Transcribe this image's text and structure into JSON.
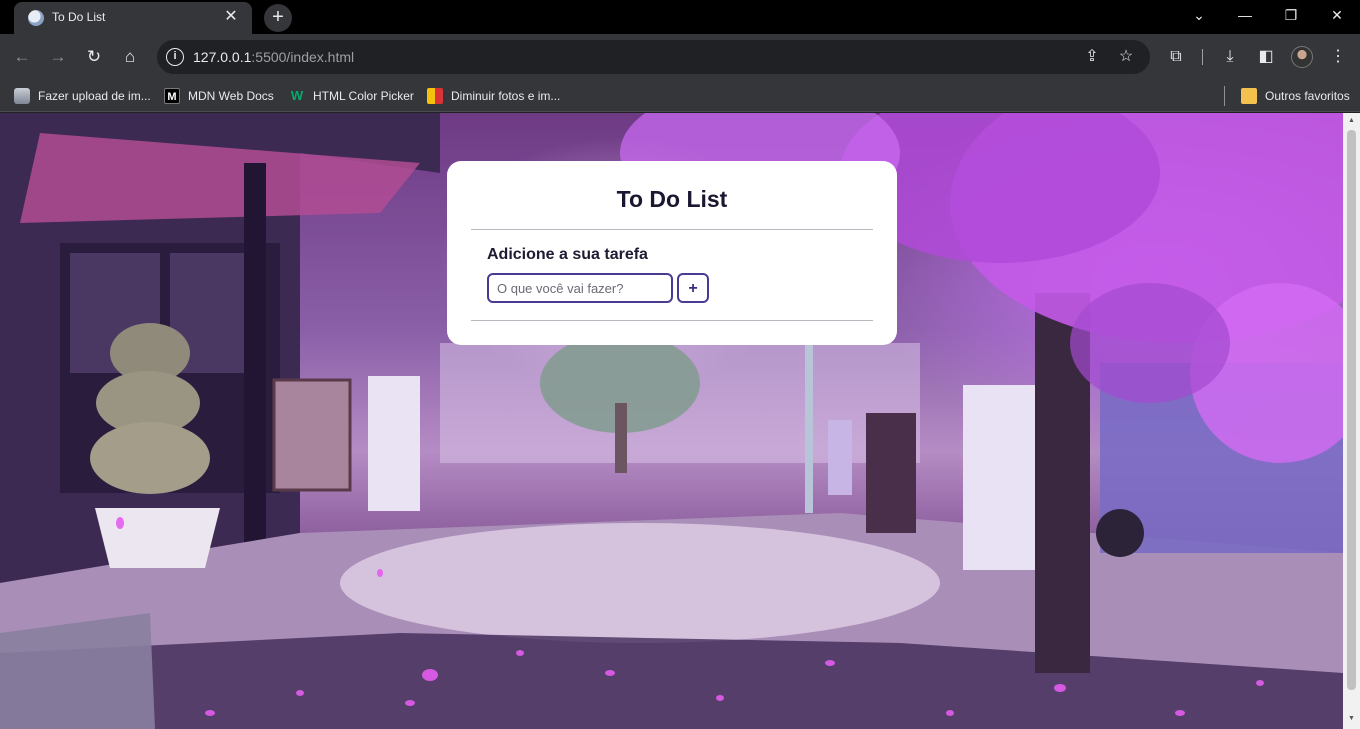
{
  "browser": {
    "tab": {
      "title": "To Do List",
      "close_glyph": "✕"
    },
    "new_tab_glyph": "+",
    "window_controls": {
      "minimize": "—",
      "restore": "❐",
      "close": "✕",
      "tabsearch": "⌄"
    },
    "address": {
      "host": "127.0.0.1",
      "rest": ":5500/index.html"
    },
    "bookmarks": [
      {
        "label": "Fazer upload de im...",
        "icon": "cloud-icon"
      },
      {
        "label": "MDN Web Docs",
        "icon": "mdn-icon"
      },
      {
        "label": "HTML Color Picker",
        "icon": "w3schools-icon"
      },
      {
        "label": "Diminuir fotos e im...",
        "icon": "easy-icon"
      }
    ],
    "other_bookmarks": "Outros favoritos"
  },
  "page": {
    "title": "To Do List",
    "subtitle": "Adicione a sua tarefa",
    "input_placeholder": "O que você vai fazer?",
    "add_button": "+"
  },
  "colors": {
    "accent": "#4b3a94",
    "card_bg": "#ffffff",
    "background_tint": "#8a4fc0"
  }
}
